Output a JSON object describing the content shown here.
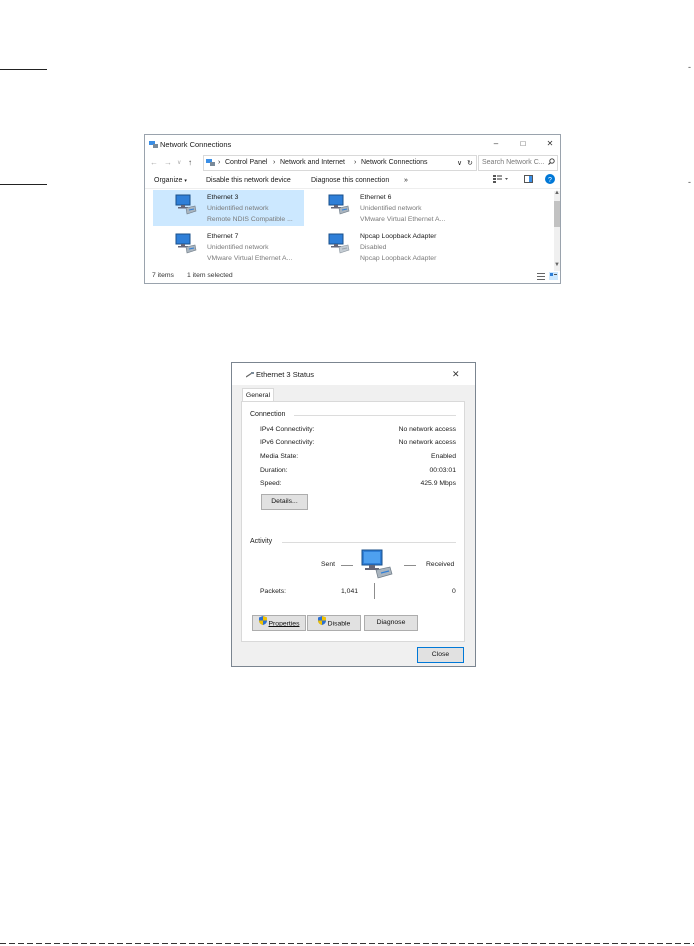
{
  "network_connections": {
    "title": "Network Connections",
    "breadcrumbs": [
      "Control Panel",
      "Network and Internet",
      "Network Connections"
    ],
    "search_placeholder": "Search Network C...",
    "commands": {
      "organize": "Organize",
      "disable": "Disable this network device",
      "diagnose": "Diagnose this connection",
      "more": "»"
    },
    "items": [
      {
        "name": "Ethernet 3",
        "status": "Unidentified network",
        "device": "Remote NDIS Compatible ...",
        "selected": true
      },
      {
        "name": "Ethernet 6",
        "status": "Unidentified network",
        "device": "VMware Virtual Ethernet A...",
        "selected": false
      },
      {
        "name": "Ethernet 7",
        "status": "Unidentified network",
        "device": "VMware Virtual Ethernet A...",
        "selected": false
      },
      {
        "name": "Npcap Loopback Adapter",
        "status": "Disabled",
        "device": "Npcap Loopback Adapter",
        "selected": false
      }
    ],
    "status_bar": {
      "items_count": "7 items",
      "selected": "1 item selected"
    }
  },
  "status_dialog": {
    "title": "Ethernet 3 Status",
    "tab": "General",
    "connection": {
      "label": "Connection",
      "rows": [
        {
          "key": "IPv4 Connectivity:",
          "value": "No network access"
        },
        {
          "key": "IPv6 Connectivity:",
          "value": "No network access"
        },
        {
          "key": "Media State:",
          "value": "Enabled"
        },
        {
          "key": "Duration:",
          "value": "00:03:01"
        },
        {
          "key": "Speed:",
          "value": "425.9 Mbps"
        }
      ],
      "details_button": "Details..."
    },
    "activity": {
      "label": "Activity",
      "sent_label": "Sent",
      "received_label": "Received",
      "packets_label": "Packets:",
      "packets_sent": "1,041",
      "packets_received": "0"
    },
    "buttons": {
      "properties": "Properties",
      "disable": "Disable",
      "diagnose": "Diagnose",
      "close": "Close"
    }
  },
  "colors": {
    "selection": "#cce8ff",
    "accent": "#0078d7",
    "shield_blue": "#2c6fd1",
    "shield_yellow": "#f2c200"
  }
}
